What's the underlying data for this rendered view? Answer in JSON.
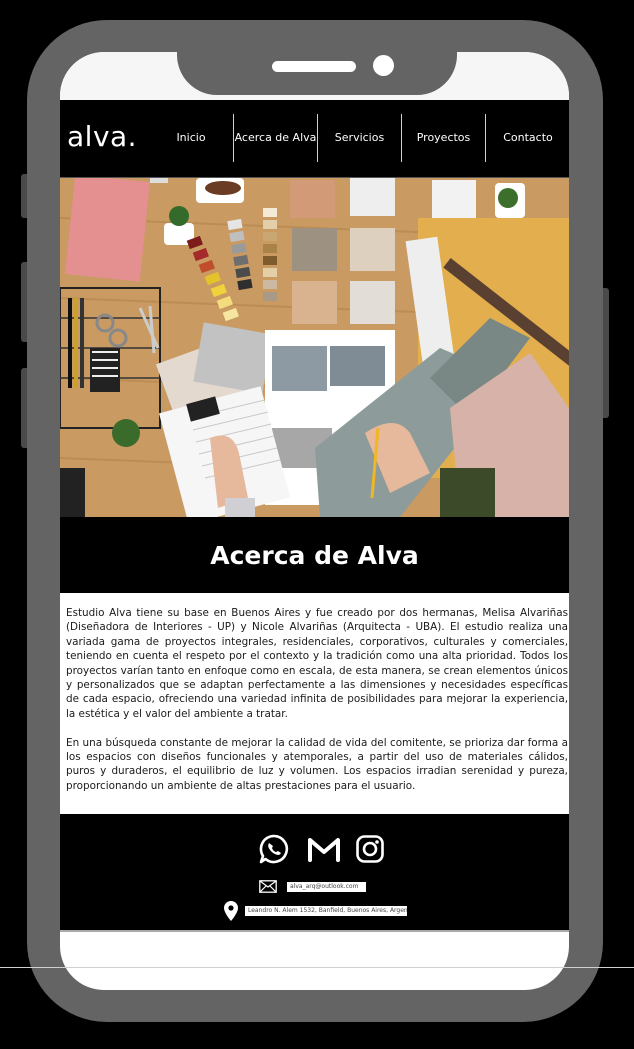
{
  "brand": {
    "logo_text": "alva",
    "logo_dot": "."
  },
  "nav": {
    "items": [
      {
        "label": "Inicio"
      },
      {
        "label": "Acerca de Alva"
      },
      {
        "label": "Servicios"
      },
      {
        "label": "Proyectos"
      },
      {
        "label": "Contacto"
      }
    ]
  },
  "hero": {
    "icon": "interior-design-moodboard-photo"
  },
  "about": {
    "heading": "Acerca de Alva",
    "paragraph_1": "Estudio Alva tiene su base en Buenos Aires y fue creado por dos hermanas, Melisa Alvariñas (Diseñadora de Interiores - UP) y Nicole Alvariñas (Arquitecta - UBA). El estudio realiza una variada gama de proyectos integrales, residenciales, corporativos, culturales y comerciales, teniendo en cuenta el respeto por el contexto y la tradición como una alta prioridad. Todos los proyectos varían tanto en enfoque como en escala, de esta manera, se crean elementos únicos y personalizados que se adaptan perfectamente a las dimensiones y necesidades específicas de cada espacio, ofreciendo una variedad infinita de posibilidades para mejorar la experiencia, la estética y el valor del ambiente a tratar.",
    "paragraph_2": "En una búsqueda constante de mejorar la calidad de vida del comitente, se prioriza dar forma a los espacios con diseños funcionales y atemporales, a partir del uso de materiales cálidos, puros y duraderos, el equilibrio de luz y volumen. Los espacios irradian serenidad y pureza, proporcionando un ambiente de altas prestaciones para el usuario."
  },
  "footer": {
    "social_icons": [
      "whatsapp-icon",
      "gmail-icon",
      "instagram-icon"
    ],
    "email": "alva_arq@outlook.com",
    "address": "Leandro N. Alem 1532, Banfield, Buenos Aires, Argentina"
  },
  "colors": {
    "frame": "#646464",
    "bar": "#000000",
    "accent_text": "#ffffff"
  }
}
